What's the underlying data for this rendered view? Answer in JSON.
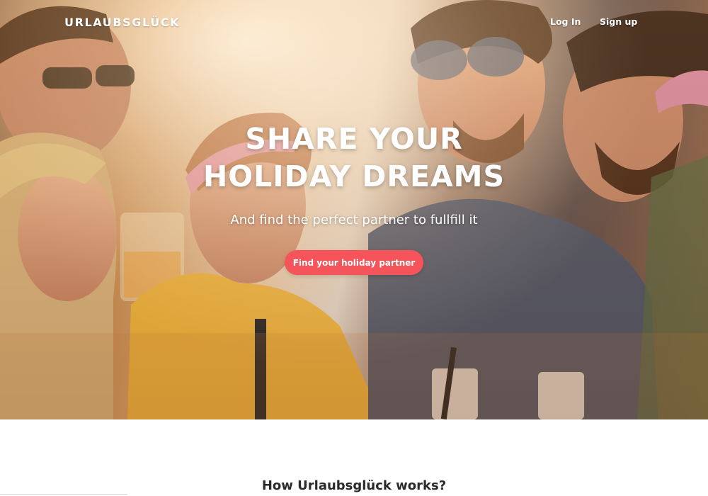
{
  "brand": "URLAUBSGLÜCK",
  "nav": {
    "login": "Log In",
    "signup": "Sign up"
  },
  "hero": {
    "headline_line1": "SHARE YOUR",
    "headline_line2": "HOLIDAY DREAMS",
    "subline": "And find the perfect partner to fullfill it",
    "cta_label": "Find your holiday partner"
  },
  "how_it_works": {
    "title": "How Urlaubsglück works?"
  },
  "colors": {
    "cta": "#f4545a",
    "text_dark": "#2a2a2a",
    "hero_text": "#ffffff"
  }
}
